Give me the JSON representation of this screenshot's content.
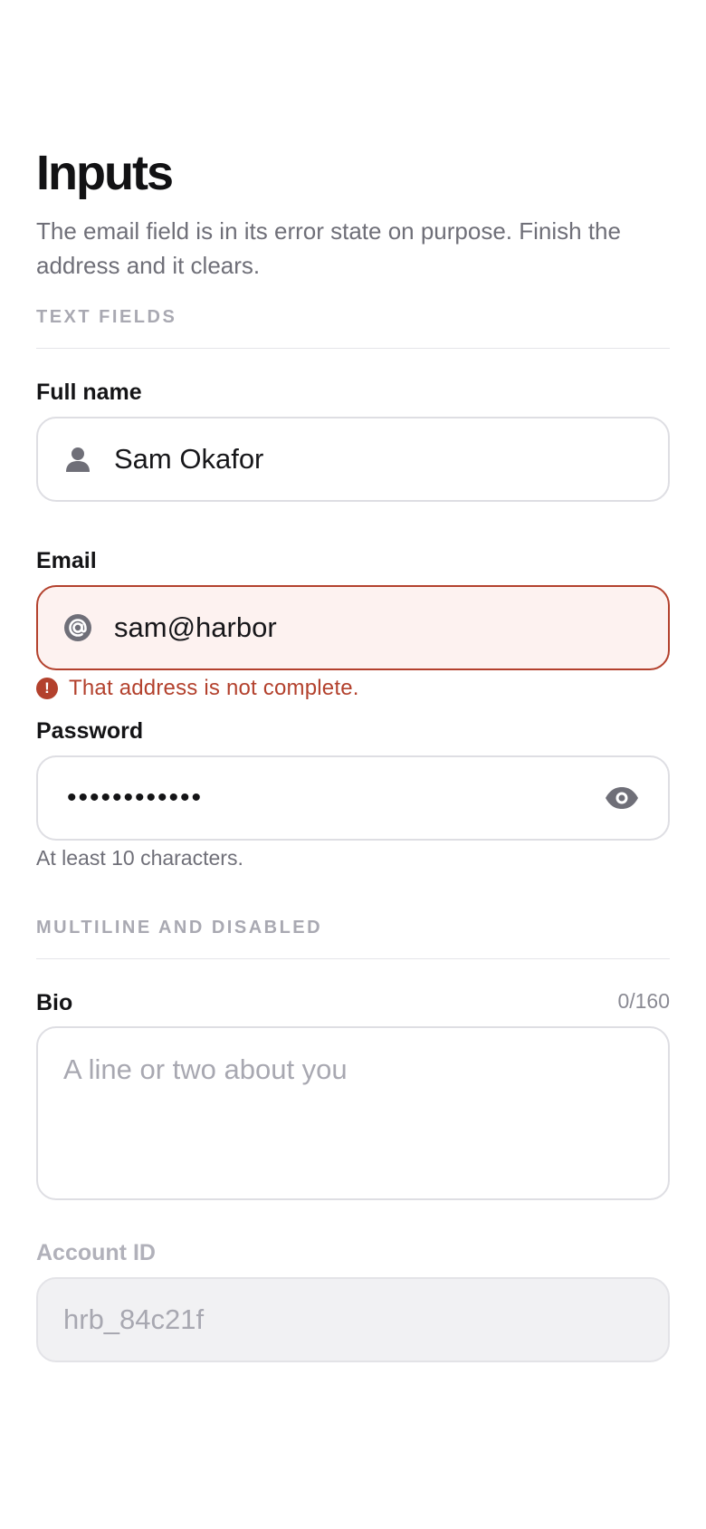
{
  "header": {
    "title": "Inputs",
    "subtitle": "The email field is in its error state on purpose. Finish the address and it clears."
  },
  "sections": {
    "text_fields": "TEXT FIELDS",
    "multiline_disabled": "MULTILINE AND DISABLED"
  },
  "fields": {
    "full_name": {
      "label": "Full name",
      "value": "Sam Okafor",
      "icon": "person-icon"
    },
    "email": {
      "label": "Email",
      "value": "sam@harbor",
      "icon": "at-icon",
      "error": "That address is not complete.",
      "error_icon": "alert-icon",
      "error_color": "#b3412d"
    },
    "password": {
      "label": "Password",
      "masked_value": "••••••••••••",
      "hint": "At least 10 characters.",
      "toggle_icon": "eye-icon"
    },
    "bio": {
      "label": "Bio",
      "placeholder": "A line or two about you",
      "counter": "0/160"
    },
    "account_id": {
      "label": "Account ID",
      "value": "hrb_84c21f",
      "disabled": true
    }
  }
}
